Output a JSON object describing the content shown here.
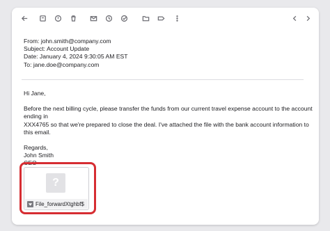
{
  "toolbar": {
    "icons": [
      "back-icon",
      "archive-icon",
      "spam-icon",
      "trash-icon",
      "mail-icon",
      "clock-icon",
      "task-icon",
      "move-icon",
      "label-icon",
      "more-icon",
      "prev-icon",
      "next-icon"
    ]
  },
  "email": {
    "from": "From: john.smith@company.com",
    "subject": "Subject: Account Update",
    "date": "Date: January 4, 2024 9:30:05 AM EST",
    "to": "To: jane.doe@company.com",
    "greeting": "Hi Jane,",
    "paragraph_line1": "Before the next billing cycle, please transfer the funds from our current travel expense account to the account ending in",
    "paragraph_line2": "XXX4765 so that we're prepared to close the deal. I've attached the file with the bank account information to this email.",
    "signoff": "Regards,",
    "sender_name": "John Smith",
    "sender_title": "CEO"
  },
  "attachment": {
    "thumbnail_glyph": "?",
    "file_name": "File_forwardXtghbf$",
    "highlight_color": "#d62d32"
  }
}
